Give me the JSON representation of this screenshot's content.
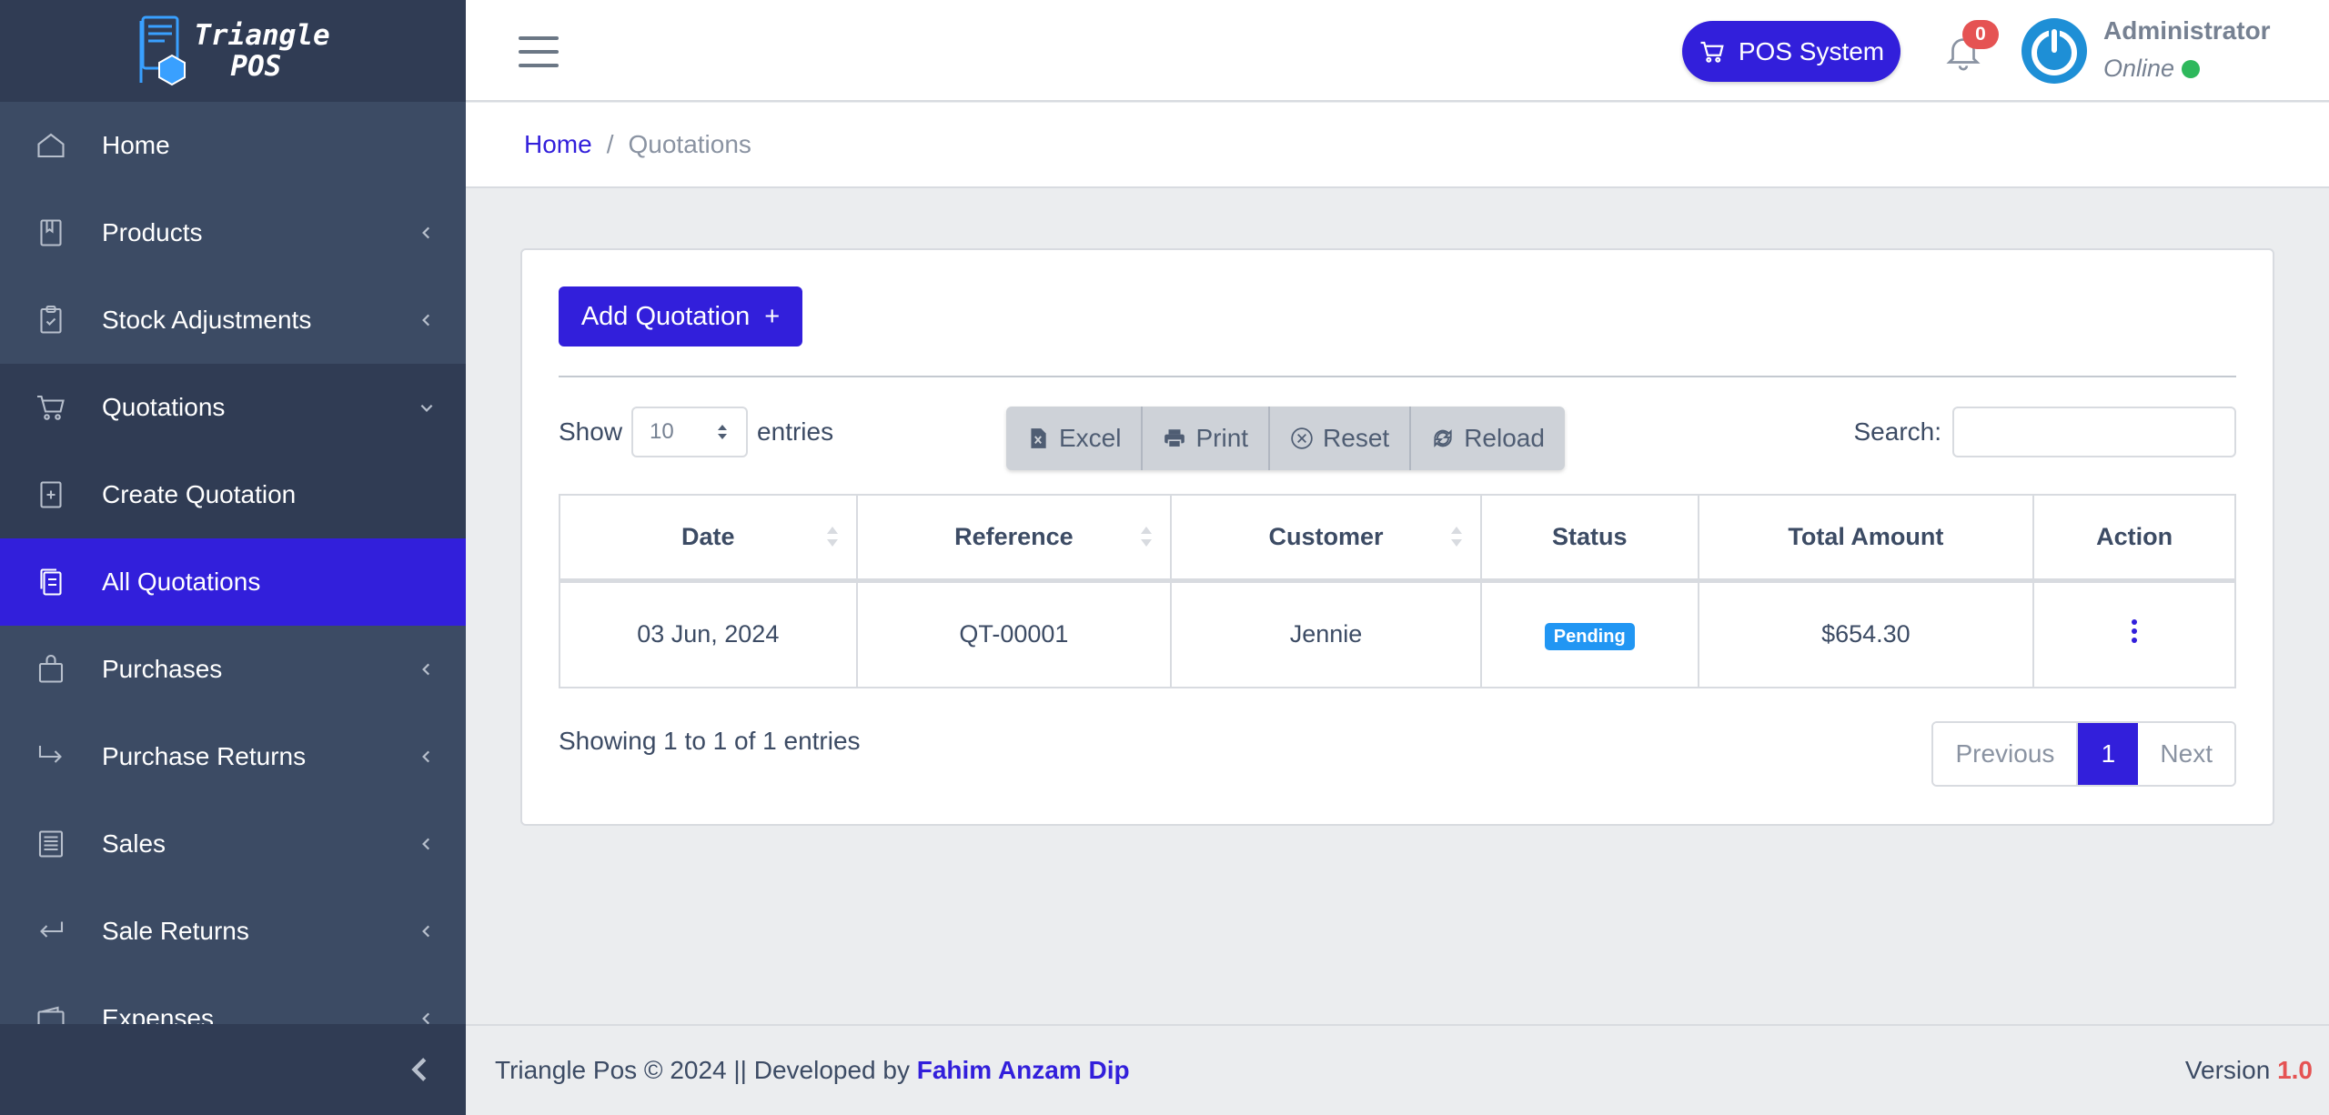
{
  "brand": {
    "line1": "Triangle",
    "line2": "POS"
  },
  "sidebar": {
    "items": [
      {
        "label": "Home",
        "icon": "home-icon"
      },
      {
        "label": "Products",
        "icon": "book-icon"
      },
      {
        "label": "Stock Adjustments",
        "icon": "clipboard-check-icon"
      },
      {
        "label": "Quotations",
        "icon": "cart-icon"
      },
      {
        "label": "Create Quotation",
        "icon": "plus-square-icon"
      },
      {
        "label": "All Quotations",
        "icon": "copy-icon"
      },
      {
        "label": "Purchases",
        "icon": "shopping-bag-icon"
      },
      {
        "label": "Purchase Returns",
        "icon": "arrow-return-right-icon"
      },
      {
        "label": "Sales",
        "icon": "receipt-icon"
      },
      {
        "label": "Sale Returns",
        "icon": "arrow-return-left-icon"
      },
      {
        "label": "Expenses",
        "icon": "wallet-icon"
      }
    ]
  },
  "header": {
    "pos_label": "POS System",
    "notification_count": "0",
    "user_name": "Administrator",
    "user_status": "Online"
  },
  "breadcrumb": {
    "home": "Home",
    "separator": "/",
    "current": "Quotations"
  },
  "main": {
    "add_button": "Add Quotation",
    "add_symbol": "+",
    "show_label": "Show",
    "entries_label": "entries",
    "page_length": "10",
    "tools": [
      "Excel",
      "Print",
      "Reset",
      "Reload"
    ],
    "search_label": "Search:",
    "search_value": "",
    "columns": [
      "Date",
      "Reference",
      "Customer",
      "Status",
      "Total Amount",
      "Action"
    ],
    "rows": [
      {
        "date": "03 Jun, 2024",
        "reference": "QT-00001",
        "customer": "Jennie",
        "status": "Pending",
        "total": "$654.30"
      }
    ],
    "info": "Showing 1 to 1 of 1 entries",
    "pagination": {
      "previous": "Previous",
      "current": "1",
      "next": "Next"
    }
  },
  "footer": {
    "text": "Triangle Pos © 2024 || Developed by",
    "developer": "Fahim Anzam Dip",
    "version_label": "Version",
    "version": "1.0"
  },
  "colors": {
    "primary": "#321fdb",
    "sidebar": "#3c4b64",
    "danger": "#e55353",
    "success": "#2eb85c",
    "info": "#2196f3"
  }
}
